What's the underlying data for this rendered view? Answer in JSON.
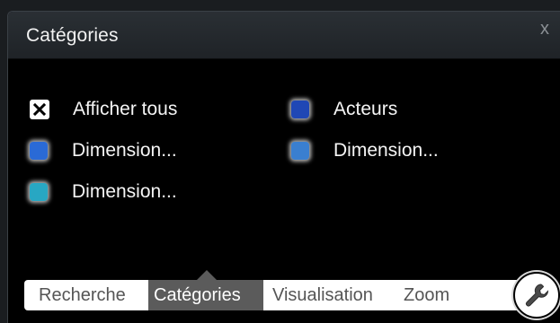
{
  "panel": {
    "title": "Catégories",
    "close_label": "x"
  },
  "categories": [
    {
      "label": "Afficher tous",
      "type": "checkbox",
      "checked": true,
      "color": "#ffffff"
    },
    {
      "label": "Acteurs",
      "type": "swatch",
      "color": "#1f47b5"
    },
    {
      "label": "Dimension...",
      "type": "swatch",
      "color": "#2a6ad6"
    },
    {
      "label": "Dimension...",
      "type": "swatch",
      "color": "#3a7fd0"
    },
    {
      "label": "Dimension...",
      "type": "swatch",
      "color": "#28a7c3"
    }
  ],
  "tabs": [
    {
      "label": "Recherche",
      "active": false
    },
    {
      "label": "Catégories",
      "active": true
    },
    {
      "label": "Visualisation",
      "active": false
    },
    {
      "label": "Zoom",
      "active": false
    }
  ],
  "tools": {
    "icon": "wrench-icon"
  },
  "colors": {
    "panel_bg": "#000000",
    "header_bg": "#2a2f34",
    "active_tab_bg": "#5b5b5b",
    "tab_text": "#555555"
  }
}
